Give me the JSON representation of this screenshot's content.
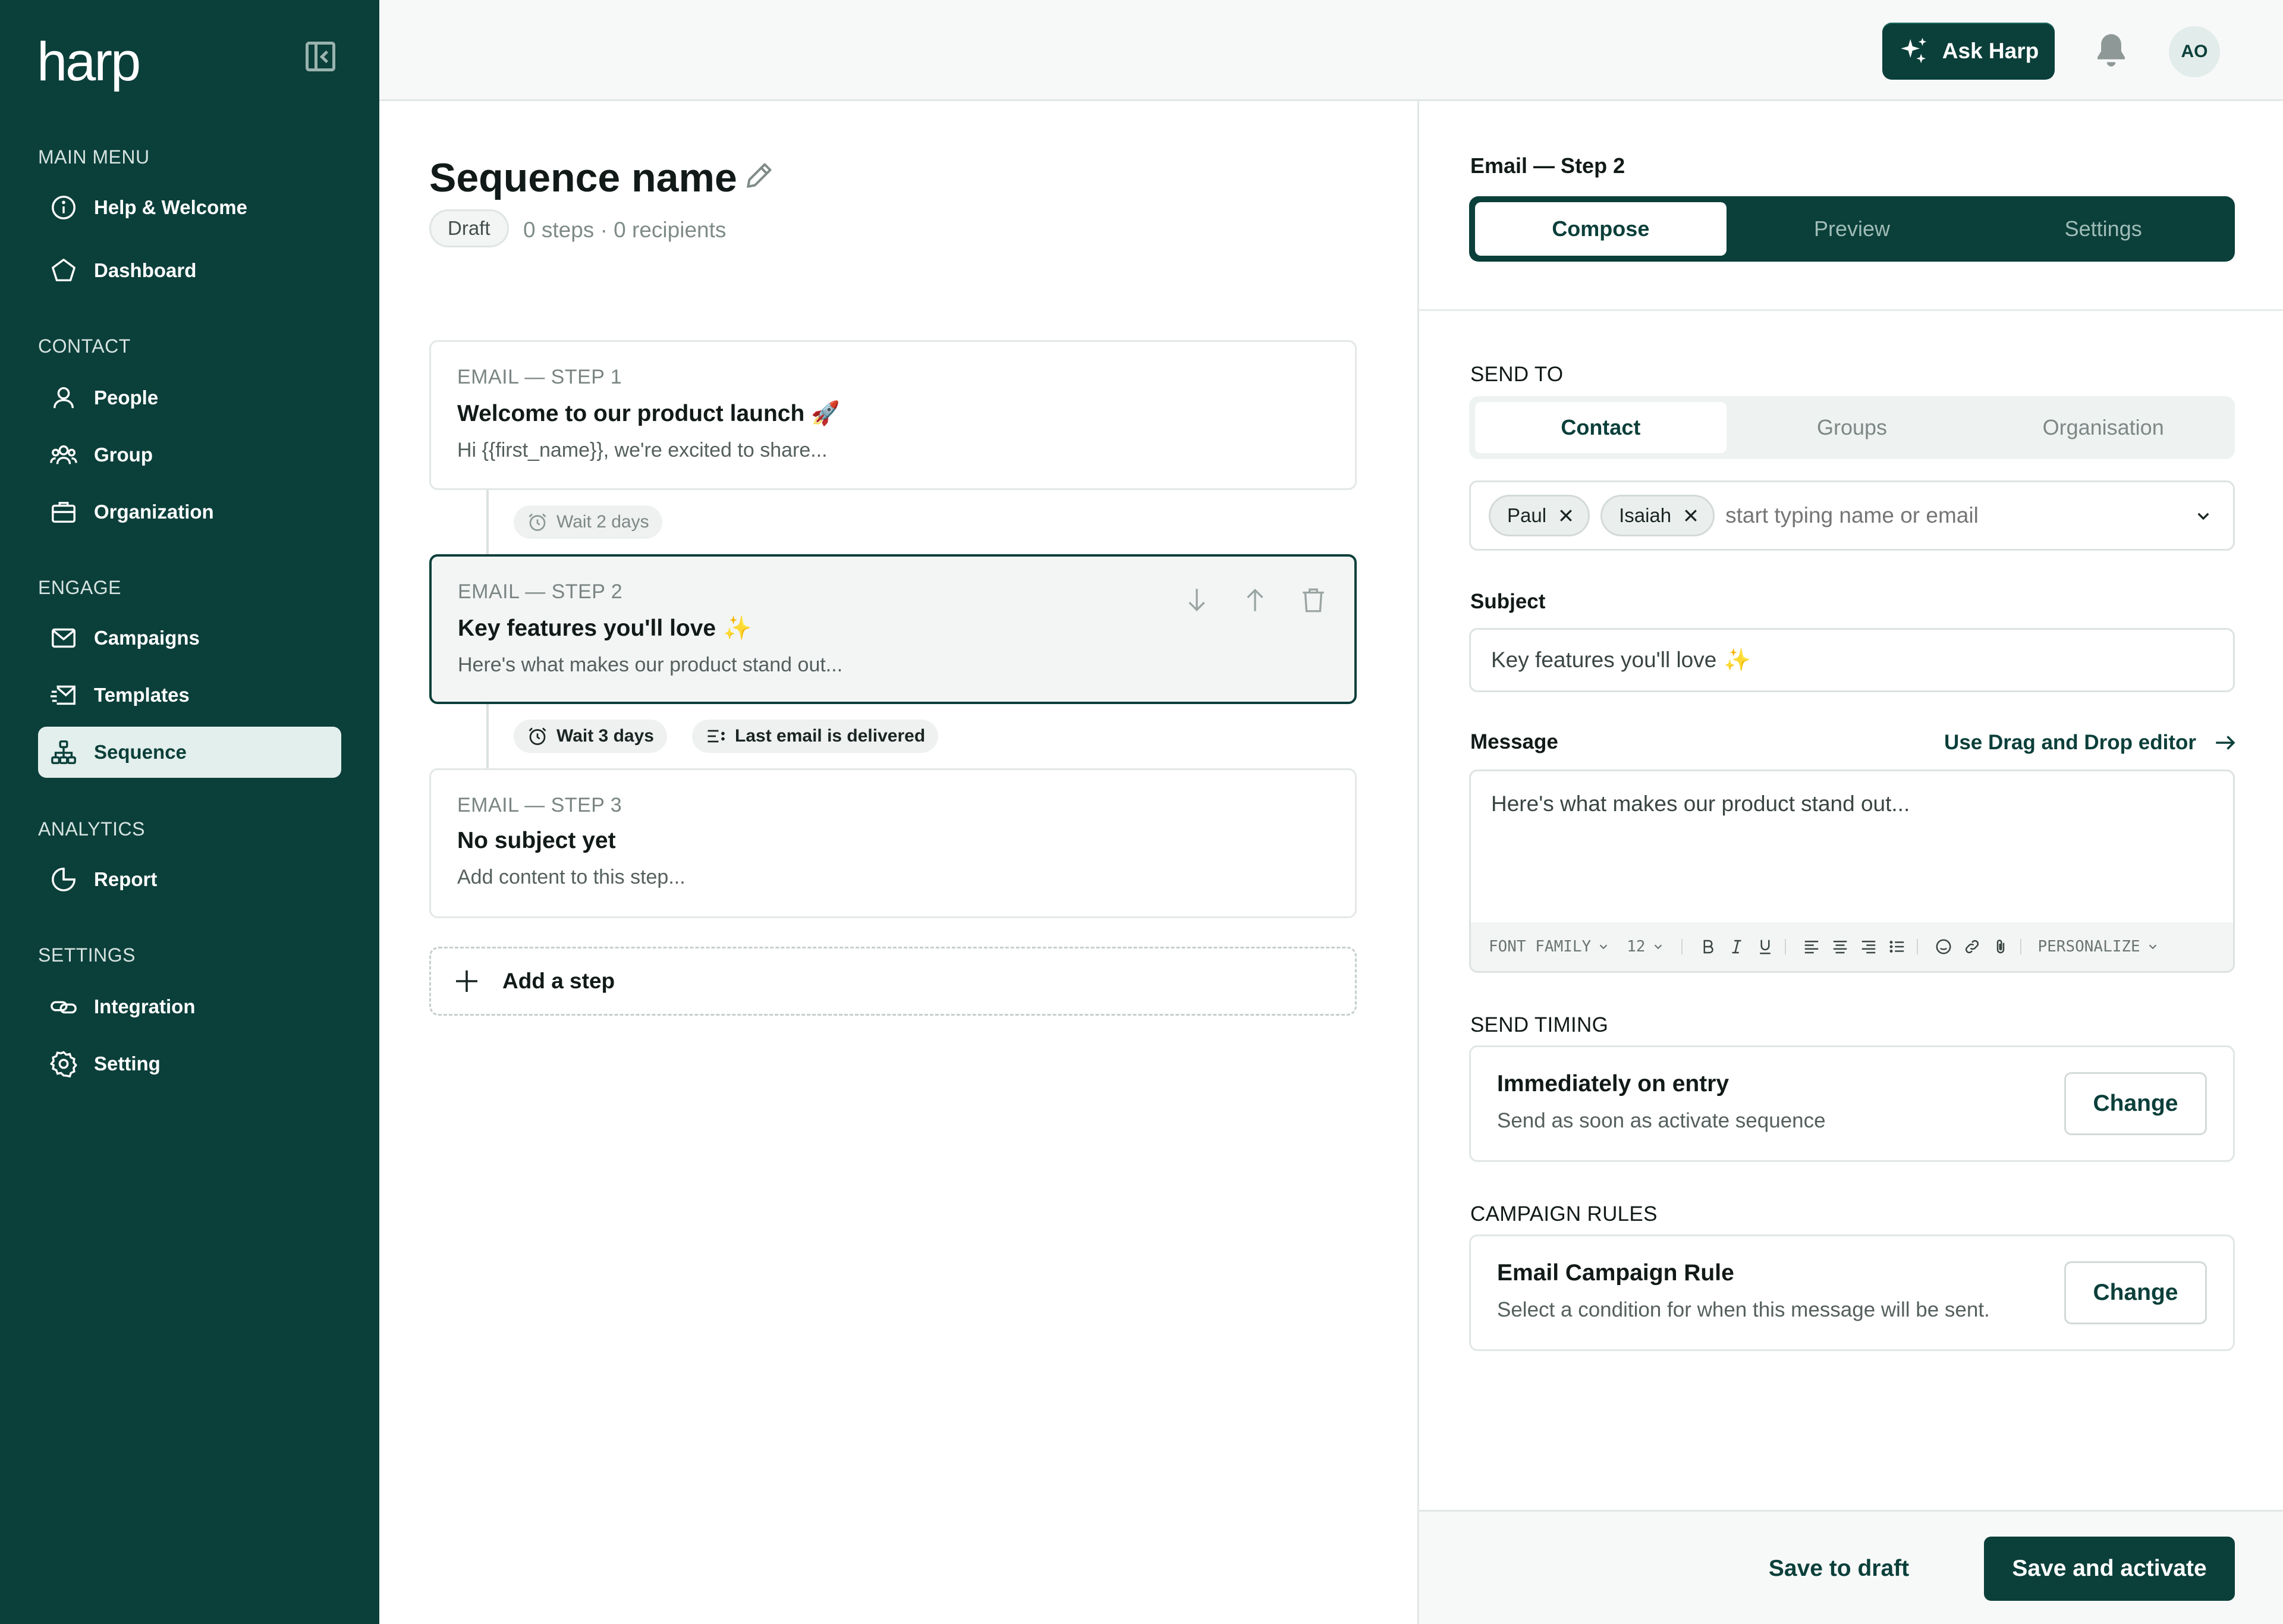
{
  "app": {
    "logo": "harp"
  },
  "sidebar": {
    "sections": [
      {
        "title": "MAIN MENU",
        "items": [
          {
            "label": "Help & Welcome",
            "icon": "info-icon"
          },
          {
            "label": "Dashboard",
            "icon": "pentagon-icon"
          }
        ]
      },
      {
        "title": "CONTACT",
        "items": [
          {
            "label": "People",
            "icon": "person-icon"
          },
          {
            "label": "Group",
            "icon": "group-icon"
          },
          {
            "label": "Organization",
            "icon": "briefcase-icon"
          }
        ]
      },
      {
        "title": "ENGAGE",
        "items": [
          {
            "label": "Campaigns",
            "icon": "mail-icon"
          },
          {
            "label": "Templates",
            "icon": "mail-send-icon"
          },
          {
            "label": "Sequence",
            "icon": "hierarchy-icon",
            "active": true
          }
        ]
      },
      {
        "title": "ANALYTICS",
        "items": [
          {
            "label": "Report",
            "icon": "pie-chart-icon"
          }
        ]
      },
      {
        "title": "SETTINGS",
        "items": [
          {
            "label": "Integration",
            "icon": "link-icon"
          },
          {
            "label": "Setting",
            "icon": "gear-icon"
          }
        ]
      }
    ]
  },
  "topbar": {
    "ask_label": "Ask Harp",
    "avatar_initials": "AO"
  },
  "sequence": {
    "title": "Sequence name",
    "status": "Draft",
    "meta": "0 steps · 0 recipients",
    "steps": [
      {
        "label": "EMAIL — STEP 1",
        "subject": "Welcome to our product launch 🚀",
        "preview": "Hi {{first_name}}, we're excited to share..."
      },
      {
        "label": "EMAIL — STEP 2",
        "subject": "Key features you'll love",
        "preview": "Here's what makes our product stand out..."
      },
      {
        "label": "EMAIL — STEP 3",
        "subject": "No subject yet",
        "preview": "Add content to this step..."
      }
    ],
    "wait_1": "Wait 2 days",
    "wait_2": "Wait 3 days",
    "condition_2": "Last email is delivered",
    "add_step": "Add a step"
  },
  "editor": {
    "header": "Email — Step 2",
    "tabs": [
      "Compose",
      "Preview",
      "Settings"
    ],
    "send_to_label": "SEND TO",
    "send_to_tabs": [
      "Contact",
      "Groups",
      "Organisation"
    ],
    "recipients": [
      "Paul",
      "Isaiah"
    ],
    "recipient_placeholder": "start typing name or email",
    "subject_label": "Subject",
    "subject_value": "Key features you'll love",
    "message_label": "Message",
    "dnd_label": "Use Drag and Drop editor",
    "message_value": "Here's what makes our product stand out...",
    "toolbar": {
      "font_family": "FONT FAMILY",
      "font_size": "12",
      "personalize": "PERSONALIZE"
    },
    "timing_label": "SEND TIMING",
    "timing_title": "Immediately on entry",
    "timing_desc": "Send as soon as activate sequence",
    "rules_label": "CAMPAIGN RULES",
    "rule_title": "Email Campaign Rule",
    "rule_desc": "Select a condition for when this message will be sent.",
    "change_label": "Change",
    "save_draft": "Save to draft",
    "save_activate": "Save and activate"
  },
  "colors": {
    "brand": "#0b3f3a",
    "sparkle": "#f3d76b"
  }
}
